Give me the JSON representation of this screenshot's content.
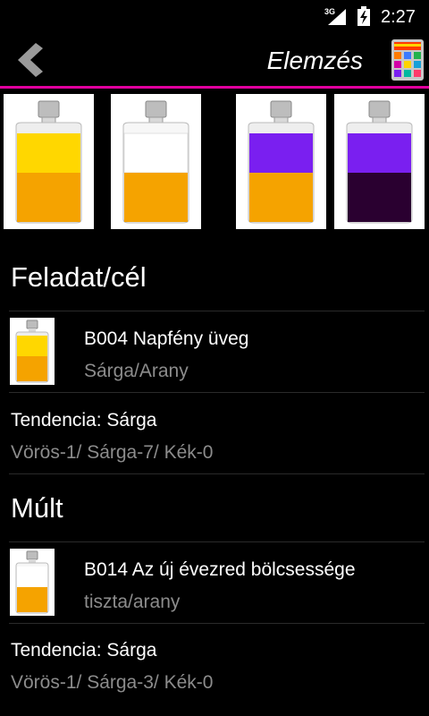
{
  "status_bar": {
    "network": "3G",
    "time": "2:27",
    "icons": [
      "signal-icon",
      "battery-icon"
    ]
  },
  "action_bar": {
    "title": "Elemzés",
    "back_icon": "chevron-left-icon",
    "grid_icon": "color-grid-icon"
  },
  "colors": {
    "accent_line": "#e0009e",
    "yellow": "#ffd700",
    "gold": "#f5a300",
    "clear": "#ffffff",
    "violet": "#7a1ff0",
    "dark_violet": "#2a0030",
    "subtext": "#8c8c8c"
  },
  "bottles": [
    {
      "name": "bottle-b004",
      "top_color": "#ffd700",
      "bottom_color": "#f5a300"
    },
    {
      "name": "bottle-b014",
      "top_color": "#ffffff",
      "bottom_color": "#f5a300"
    },
    {
      "name": "bottle-violet-gold",
      "top_color": "#7a1ff0",
      "bottom_color": "#f5a300"
    },
    {
      "name": "bottle-violet-dark",
      "top_color": "#7a1ff0",
      "bottom_color": "#2a0030"
    }
  ],
  "sections": [
    {
      "header": "Feladat/cél",
      "item": {
        "code_title": "B004  Napfény üveg",
        "colors": "Sárga/Arany"
      },
      "tendency": {
        "title": "Tendencia: Sárga",
        "values": "Vörös-1/ Sárga-7/ Kék-0"
      }
    },
    {
      "header": "Múlt",
      "item": {
        "code_title": "B014  Az új évezred bölcsessége",
        "colors": "tiszta/arany"
      },
      "tendency": {
        "title": "Tendencia: Sárga",
        "values": "Vörös-1/ Sárga-3/ Kék-0"
      }
    }
  ]
}
